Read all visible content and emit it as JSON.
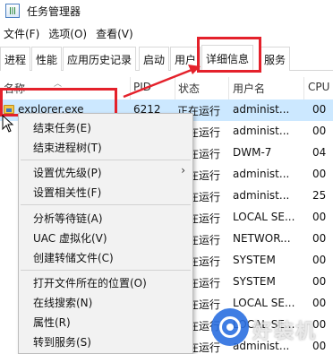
{
  "window": {
    "title": "任务管理器"
  },
  "menubar": [
    {
      "label": "文件(F)"
    },
    {
      "label": "选项(O)"
    },
    {
      "label": "查看(V)"
    }
  ],
  "tabs": [
    {
      "label": "进程"
    },
    {
      "label": "性能"
    },
    {
      "label": "应用历史记录"
    },
    {
      "label": "启动"
    },
    {
      "label": "用户"
    },
    {
      "label": "详细信息",
      "active": true
    },
    {
      "label": "服务"
    }
  ],
  "columns": {
    "name": "名称",
    "pid": "PID",
    "status": "状态",
    "user": "用户名",
    "cpu": "CPU"
  },
  "rows": [
    {
      "name": "explorer.exe",
      "pid": "6212",
      "status": "正在运行",
      "user": "administ...",
      "cpu": "00",
      "selected": true
    },
    {
      "name": "",
      "pid": "",
      "status": "正在运行",
      "user": "administ...",
      "cpu": "00"
    },
    {
      "name": "",
      "pid": "",
      "status": "正在运行",
      "user": "DWM-7",
      "cpu": "04"
    },
    {
      "name": "",
      "pid": "",
      "status": "正在运行",
      "user": "administ...",
      "cpu": "00"
    },
    {
      "name": "",
      "pid": "",
      "status": "正在运行",
      "user": "administ...",
      "cpu": "25"
    },
    {
      "name": "",
      "pid": "",
      "status": "正在运行",
      "user": "LOCAL SE...",
      "cpu": "00"
    },
    {
      "name": "",
      "pid": "",
      "status": "正在运行",
      "user": "NETWOR...",
      "cpu": "00"
    },
    {
      "name": "",
      "pid": "",
      "status": "正在运行",
      "user": "SYSTEM",
      "cpu": "00"
    },
    {
      "name": "",
      "pid": "",
      "status": "正在运行",
      "user": "SYSTEM",
      "cpu": "00"
    },
    {
      "name": "",
      "pid": "",
      "status": "正在运行",
      "user": "LOCAL SE...",
      "cpu": "00"
    },
    {
      "name": "",
      "pid": "",
      "status": "正在运行",
      "user": "LOCAL SE...",
      "cpu": "00"
    },
    {
      "name": "",
      "pid": "",
      "status": "正在运行",
      "user": "administ...",
      "cpu": "00"
    }
  ],
  "context_menu": {
    "end_task": "结束任务(E)",
    "end_process_tree": "结束进程树(T)",
    "set_priority": "设置优先级(P)",
    "set_affinity": "设置相关性(F)",
    "analyze_wait_chain": "分析等待链(A)",
    "uac_virtualization": "UAC 虚拟化(V)",
    "create_dump_file": "创建转储文件(C)",
    "open_file_location": "打开文件所在的位置(O)",
    "search_online": "在线搜索(N)",
    "properties": "属性(R)",
    "go_to_services": "转到服务(S)"
  },
  "watermark": {
    "text": "好装机"
  },
  "colors": {
    "annotation_red": "#e4212b",
    "selection_blue": "#cce8ff",
    "watermark_blue": "#2b6fe0"
  }
}
